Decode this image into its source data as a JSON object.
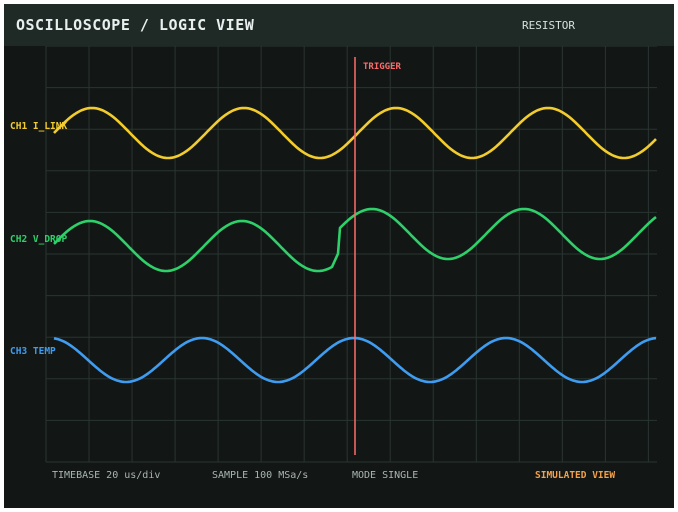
{
  "header": {
    "title": "OSCILLOSCOPE / LOGIC VIEW",
    "component": "RESISTOR"
  },
  "trigger": {
    "label": "TRIGGER",
    "color": "#ff6b6b"
  },
  "channels": [
    {
      "label": "CH1 I_LINK",
      "color": "#f2cc2e"
    },
    {
      "label": "CH2 V_DROP",
      "color": "#2fcf6a"
    },
    {
      "label": "CH3 TEMP",
      "color": "#3f9cf0"
    }
  ],
  "footer": {
    "timebase": "TIMEBASE  20 us/div",
    "sample": "SAMPLE 100 MSa/s",
    "mode": "MODE SINGLE",
    "simulated": "SIMULATED VIEW",
    "simulated_color": "#f4a14a"
  },
  "colors": {
    "background": "#121715",
    "header": "#1f2a27",
    "grid": "#2a3431"
  }
}
